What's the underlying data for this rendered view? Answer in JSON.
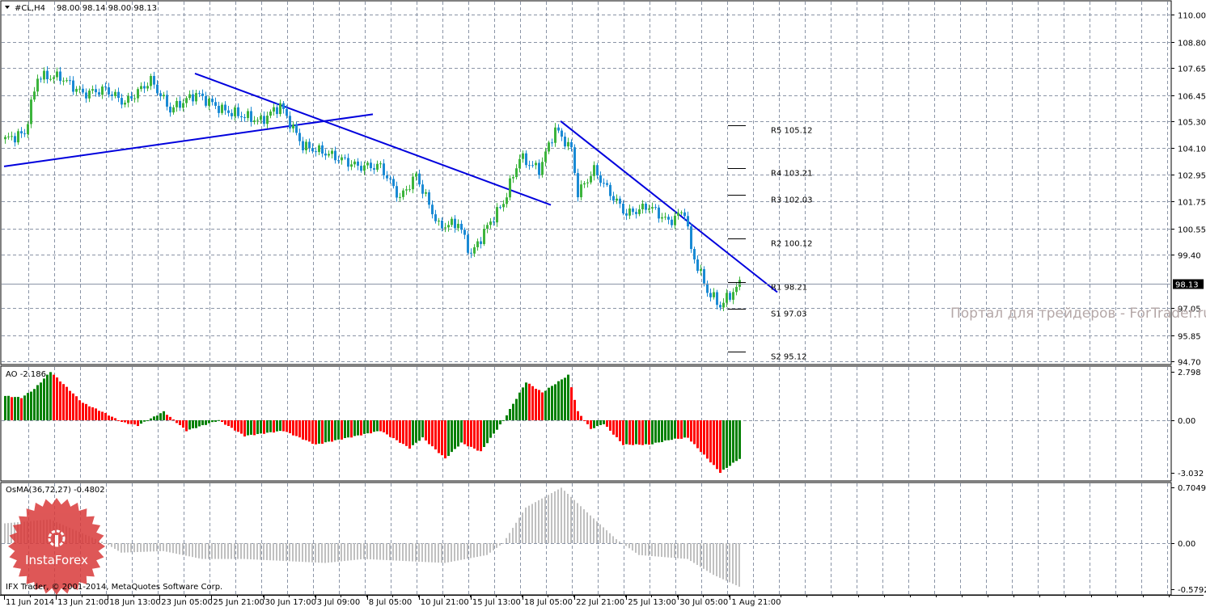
{
  "header": {
    "symbol": "#CL,H4",
    "ohlc": "98.00 98.14 98.00 98.13"
  },
  "watermark": "Портал для трейдеров - ForTrader.ru",
  "logo_text": "InstaForex",
  "copyright": "IFX Trader, © 2001-2014, MetaQuotes Software Corp.",
  "colors": {
    "bull": "#3cb43c",
    "bear": "#1a8ad4",
    "trendline": "#0000dd",
    "ao_up": "#008000",
    "ao_down": "#ff0000",
    "osma": "#c0c0c0",
    "grid": "#8a94a6",
    "logo": "#d93a3a"
  },
  "chart_data": [
    {
      "type": "candlestick",
      "title": "#CL,H4",
      "price_ticks": [
        "110.00",
        "108.80",
        "107.65",
        "106.45",
        "105.30",
        "104.10",
        "102.95",
        "101.75",
        "100.55",
        "99.40",
        "97.05",
        "95.85",
        "94.70"
      ],
      "ylim": [
        94.7,
        110.0
      ],
      "current_price": "98.13",
      "close_keypoints": [
        [
          0,
          104.5
        ],
        [
          6,
          104.75
        ],
        [
          10,
          107.25
        ],
        [
          17,
          107.25
        ],
        [
          24,
          106.5
        ],
        [
          31,
          106.7
        ],
        [
          37,
          106.1
        ],
        [
          45,
          107.1
        ],
        [
          51,
          105.8
        ],
        [
          59,
          106.5
        ],
        [
          67,
          105.8
        ],
        [
          79,
          105.3
        ],
        [
          85,
          106.0
        ],
        [
          92,
          104.2
        ],
        [
          99,
          103.9
        ],
        [
          109,
          103.3
        ],
        [
          116,
          103.3
        ],
        [
          122,
          101.9
        ],
        [
          127,
          102.9
        ],
        [
          134,
          100.65
        ],
        [
          140,
          100.8
        ],
        [
          144,
          99.4
        ],
        [
          149,
          100.65
        ],
        [
          154,
          101.7
        ],
        [
          159,
          103.7
        ],
        [
          165,
          103.15
        ],
        [
          170,
          104.95
        ],
        [
          175,
          104.05
        ],
        [
          177,
          102.1
        ],
        [
          182,
          103.15
        ],
        [
          187,
          102.1
        ],
        [
          192,
          101.2
        ],
        [
          199,
          101.55
        ],
        [
          205,
          100.85
        ],
        [
          210,
          101.35
        ],
        [
          212,
          99.6
        ],
        [
          217,
          97.8
        ],
        [
          221,
          97.15
        ],
        [
          227,
          98.1
        ]
      ],
      "pivots": [
        {
          "label": "R5 105.12",
          "price": 105.12
        },
        {
          "label": "R4 103.21",
          "price": 103.21
        },
        {
          "label": "R3 102.03",
          "price": 102.03
        },
        {
          "label": "R2 100.12",
          "price": 100.12
        },
        {
          "label": "R1 98.21",
          "price": 98.21
        },
        {
          "label": "S1 97.03",
          "price": 97.03
        },
        {
          "label": "S2 95.12",
          "price": 95.12
        }
      ],
      "trendlines": [
        {
          "from": [
            0,
            103.3
          ],
          "to": [
            114,
            105.6
          ]
        },
        {
          "from": [
            59,
            107.4
          ],
          "to": [
            169,
            101.6
          ]
        },
        {
          "from": [
            172,
            105.3
          ],
          "to": [
            239,
            97.75
          ]
        }
      ],
      "time_labels": [
        "11 Jun 2014",
        "13 Jun 21:00",
        "18 Jun 13:00",
        "23 Jun 05:00",
        "25 Jun 21:00",
        "30 Jun 17:00",
        "3 Jul 09:00",
        "8 Jul 05:00",
        "10 Jul 21:00",
        "15 Jul 13:00",
        "18 Jul 05:00",
        "22 Jul 21:00",
        "25 Jul 13:00",
        "30 Jul 05:00",
        "1 Aug 21:00"
      ]
    },
    {
      "type": "bar",
      "title": "AO -2.186",
      "ticks": [
        "2.798",
        "0.00",
        "-3.032"
      ],
      "ylim": [
        -3.032,
        2.798
      ],
      "keypoints": [
        [
          0,
          1.4
        ],
        [
          5,
          1.3
        ],
        [
          9,
          1.8
        ],
        [
          14,
          2.8
        ],
        [
          24,
          1.0
        ],
        [
          31,
          0.4
        ],
        [
          36,
          -0.1
        ],
        [
          41,
          -0.3
        ],
        [
          49,
          0.5
        ],
        [
          56,
          -0.6
        ],
        [
          66,
          0.0
        ],
        [
          74,
          -0.9
        ],
        [
          86,
          -0.6
        ],
        [
          96,
          -1.4
        ],
        [
          106,
          -1.0
        ],
        [
          116,
          -0.6
        ],
        [
          125,
          -1.6
        ],
        [
          129,
          -1.0
        ],
        [
          136,
          -2.2
        ],
        [
          141,
          -1.3
        ],
        [
          147,
          -1.8
        ],
        [
          154,
          0.0
        ],
        [
          161,
          2.2
        ],
        [
          166,
          1.6
        ],
        [
          174,
          2.6
        ],
        [
          177,
          0.5
        ],
        [
          181,
          -0.5
        ],
        [
          185,
          -0.2
        ],
        [
          191,
          -1.4
        ],
        [
          199,
          -1.4
        ],
        [
          206,
          -1.1
        ],
        [
          211,
          -1.0
        ],
        [
          221,
          -3.0
        ],
        [
          227,
          -2.2
        ]
      ]
    },
    {
      "type": "bar",
      "title": "OsMA(36,72,27) -0.4802",
      "ticks": [
        "0.7049",
        "0.00",
        "-0.5792"
      ],
      "ylim": [
        -0.5792,
        0.7049
      ],
      "keypoints": [
        [
          0,
          0.25
        ],
        [
          14,
          0.3
        ],
        [
          31,
          0.0
        ],
        [
          36,
          -0.12
        ],
        [
          49,
          -0.1
        ],
        [
          61,
          -0.2
        ],
        [
          74,
          -0.2
        ],
        [
          99,
          -0.25
        ],
        [
          111,
          -0.2
        ],
        [
          136,
          -0.25
        ],
        [
          149,
          -0.15
        ],
        [
          154,
          0.0
        ],
        [
          161,
          0.45
        ],
        [
          172,
          0.7
        ],
        [
          181,
          0.35
        ],
        [
          189,
          0.05
        ],
        [
          196,
          -0.15
        ],
        [
          211,
          -0.2
        ],
        [
          219,
          -0.4
        ],
        [
          227,
          -0.55
        ]
      ]
    }
  ]
}
